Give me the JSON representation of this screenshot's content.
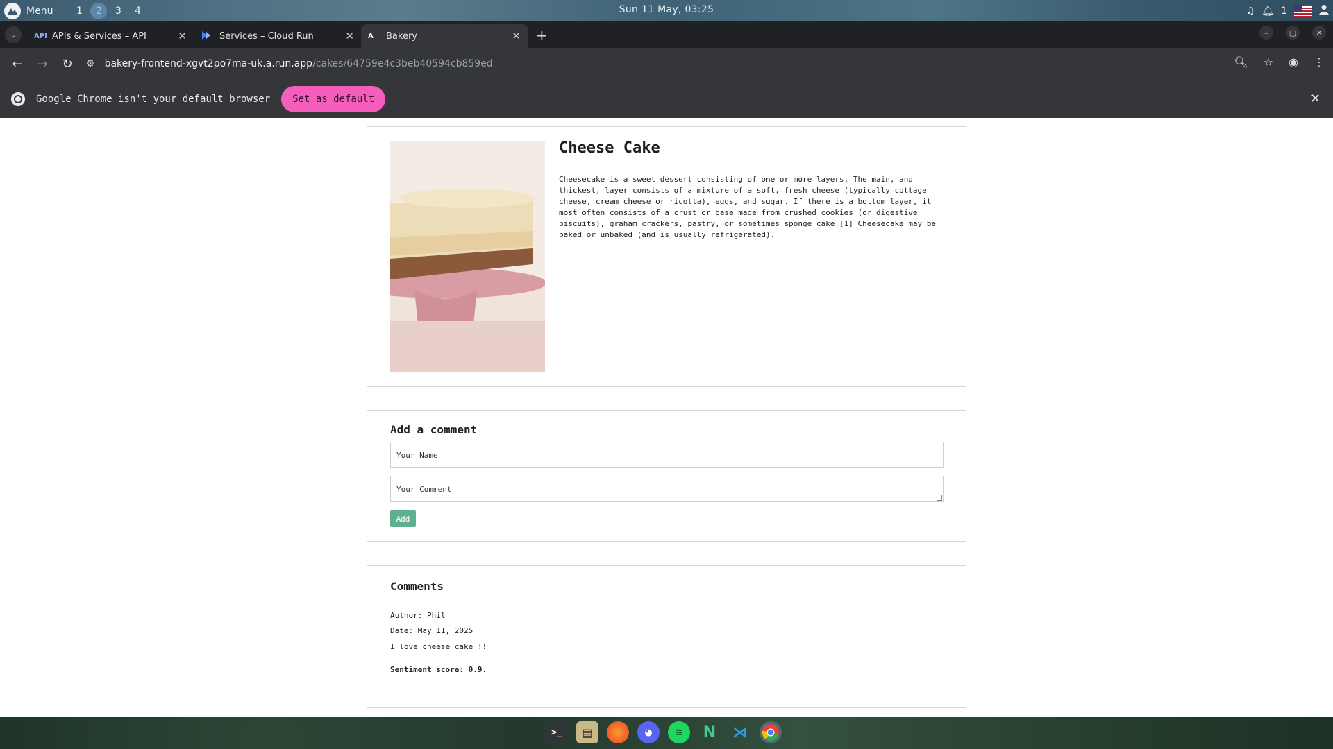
{
  "panel": {
    "menu_label": "Menu",
    "workspaces": [
      "1",
      "2",
      "3",
      "4"
    ],
    "clock": "Sun 11 May, 03:25",
    "notif_count": "1"
  },
  "browser": {
    "tabs": [
      {
        "favicon": "API",
        "title": "APIs & Services – API"
      },
      {
        "favicon": "cloud-run-icon",
        "title": "Services – Cloud Run"
      },
      {
        "favicon": "A",
        "title": "Bakery"
      }
    ],
    "url_host": "bakery-frontend-xgvt2po7ma-uk.a.run.app",
    "url_path": "/cakes/64759e4c3beb40594cb859ed",
    "infobar_text": "Google Chrome isn't your default browser",
    "set_default_label": "Set as default"
  },
  "cake": {
    "title": "Cheese Cake",
    "description": "Cheesecake is a sweet dessert consisting of one or more layers. The main, and thickest, layer consists of a mixture of a soft, fresh cheese (typically cottage cheese, cream cheese or ricotta), eggs, and sugar. If there is a bottom layer, it most often consists of a crust or base made from crushed cookies (or digestive biscuits), graham crackers, pastry, or sometimes sponge cake.[1] Cheesecake may be baked or unbaked (and is usually refrigerated)."
  },
  "comment_form": {
    "title": "Add a comment",
    "name_placeholder": "Your Name",
    "comment_placeholder": "Your Comment",
    "add_label": "Add"
  },
  "comments": {
    "title": "Comments",
    "items": [
      {
        "author": "Author: Phil",
        "date": "Date: May 11, 2025",
        "text": "I love cheese cake !!",
        "sentiment": "Sentiment score: 0.9."
      }
    ]
  },
  "dock": [
    "terminal-icon",
    "files-icon",
    "firefox-icon",
    "discord-icon",
    "spotify-icon",
    "notion-icon",
    "vscode-icon",
    "chrome-icon"
  ],
  "colors": {
    "accent_pink": "#f55ebc",
    "add_button": "#5fae8e",
    "chrome_dark": "#202124"
  }
}
